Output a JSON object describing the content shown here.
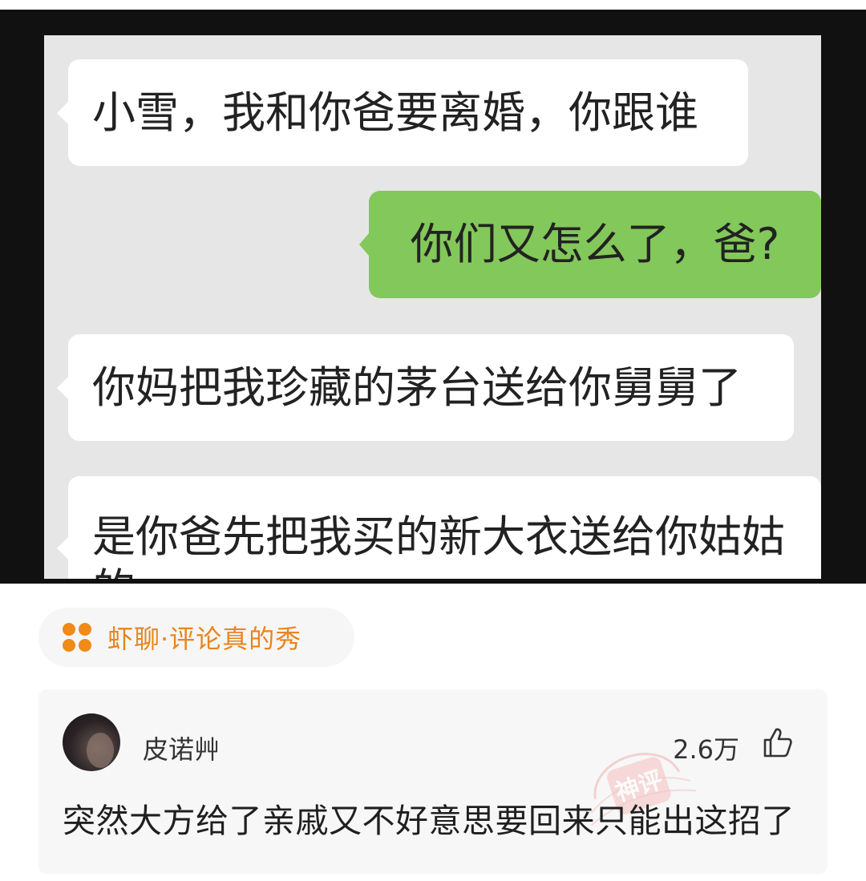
{
  "chat": {
    "messages": [
      {
        "side": "left",
        "text": "小雪，我和你爸要离婚，你跟谁"
      },
      {
        "side": "right",
        "text": "你们又怎么了，爸?"
      },
      {
        "side": "left",
        "text": "你妈把我珍藏的茅台送给你舅舅了"
      },
      {
        "side": "left",
        "text": "是你爸先把我买的新大衣送给你姑姑",
        "continuation": "的"
      }
    ]
  },
  "topic": {
    "label": "虾聊·评论真的秀",
    "icon": "four-dots-icon",
    "color": "#f08a19"
  },
  "comment": {
    "username": "皮诺艸",
    "likes": "2.6万",
    "text": "突然大方给了亲戚又不好意思要回来只能出这招了",
    "stamp_text": "神评"
  },
  "colors": {
    "incoming_bubble": "#ffffff",
    "outgoing_bubble": "#83c85a",
    "chat_background": "#e6e6e6",
    "accent": "#f08a19"
  }
}
